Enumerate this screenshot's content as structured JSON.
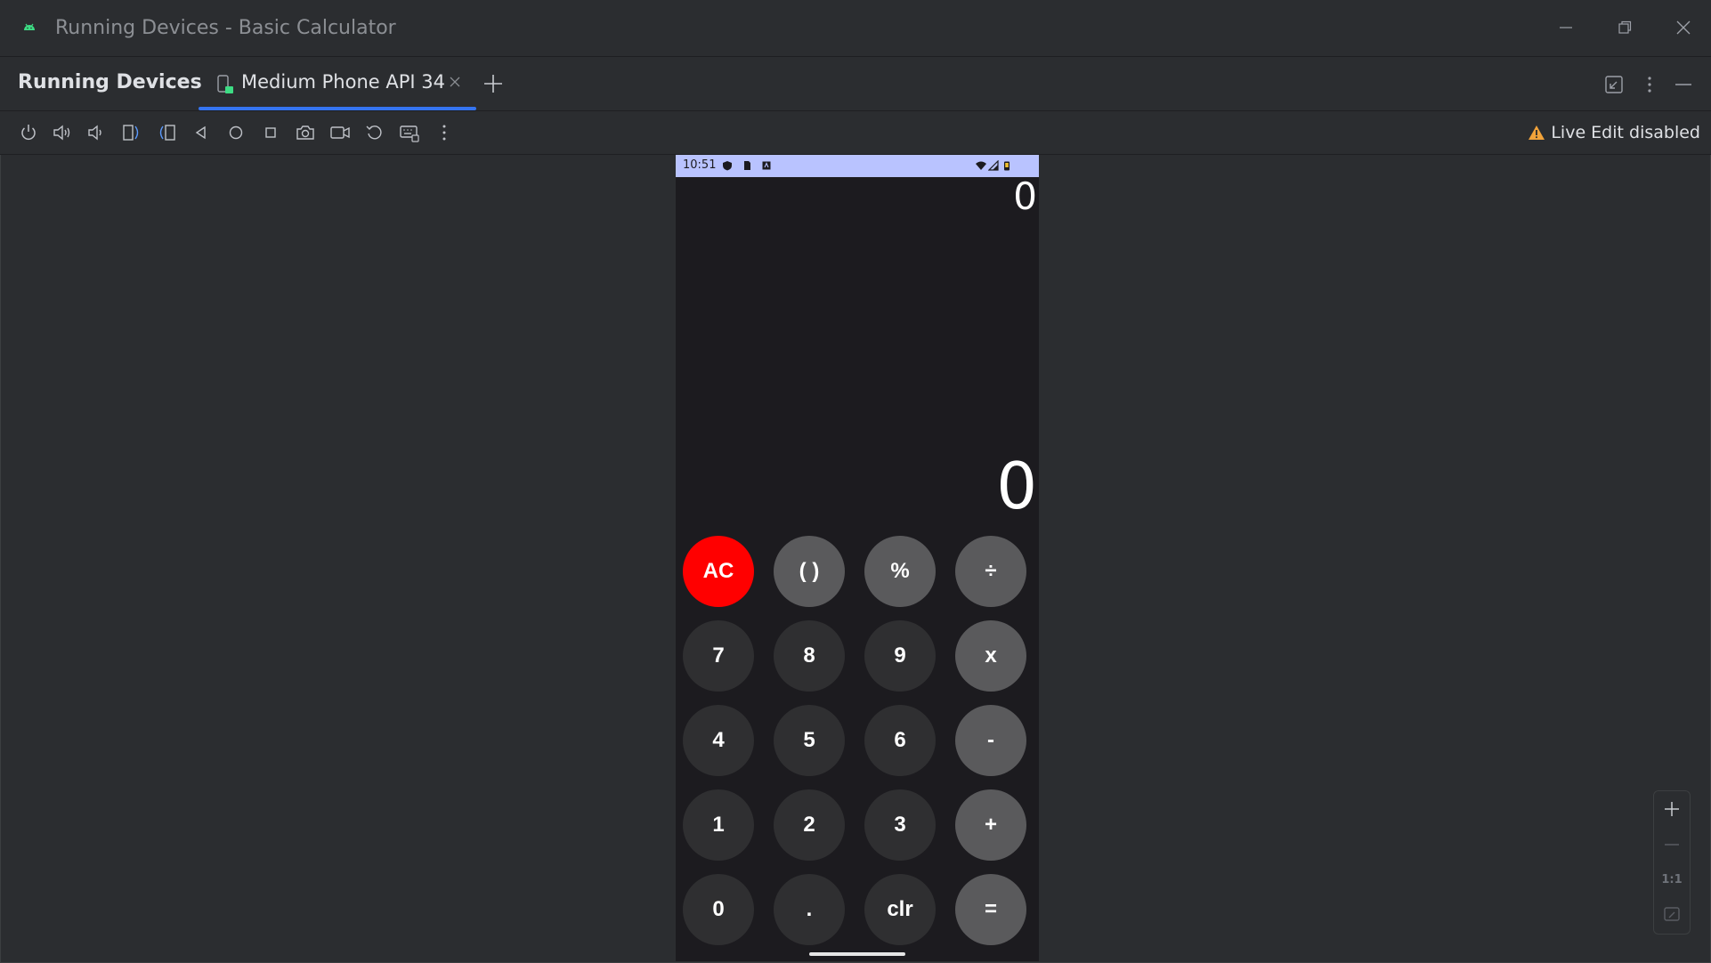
{
  "window": {
    "title": "Running Devices - Basic Calculator",
    "controls": [
      "minimize",
      "restore",
      "close"
    ]
  },
  "tool_window": {
    "title": "Running Devices",
    "tabs": [
      {
        "label": "Medium Phone API 34",
        "active": true
      }
    ],
    "header_actions": [
      "collapse-icon",
      "more-icon",
      "hide-icon"
    ]
  },
  "toolbar": {
    "buttons": [
      "power-icon",
      "volume-up-icon",
      "volume-down-icon",
      "rotate-left-icon",
      "rotate-right-icon",
      "back-icon",
      "home-icon",
      "overview-icon",
      "screenshot-icon",
      "screen-record-icon",
      "reset-icon",
      "keyboard-icon",
      "more-vertical-icon"
    ],
    "live_edit_status": "Live Edit disabled",
    "warning_color": "#f2a33a"
  },
  "device": {
    "status_bar": {
      "time": "10:51",
      "background": "#b9c3ff"
    },
    "calculator": {
      "expression": "0",
      "result": "0",
      "keys": [
        [
          "AC",
          "( )",
          "%",
          "÷"
        ],
        [
          "7",
          "8",
          "9",
          "x"
        ],
        [
          "4",
          "5",
          "6",
          "-"
        ],
        [
          "1",
          "2",
          "3",
          "+"
        ],
        [
          "0",
          ".",
          "clr",
          "="
        ]
      ],
      "colors": {
        "ac": "#ff0000",
        "operator": "#5a5a5c",
        "digit": "#2f2f31"
      }
    }
  },
  "zoom_controls": {
    "zoom_in": "+",
    "zoom_out": "—",
    "actual_size": "1:1",
    "fit": "fit-screen-icon"
  }
}
